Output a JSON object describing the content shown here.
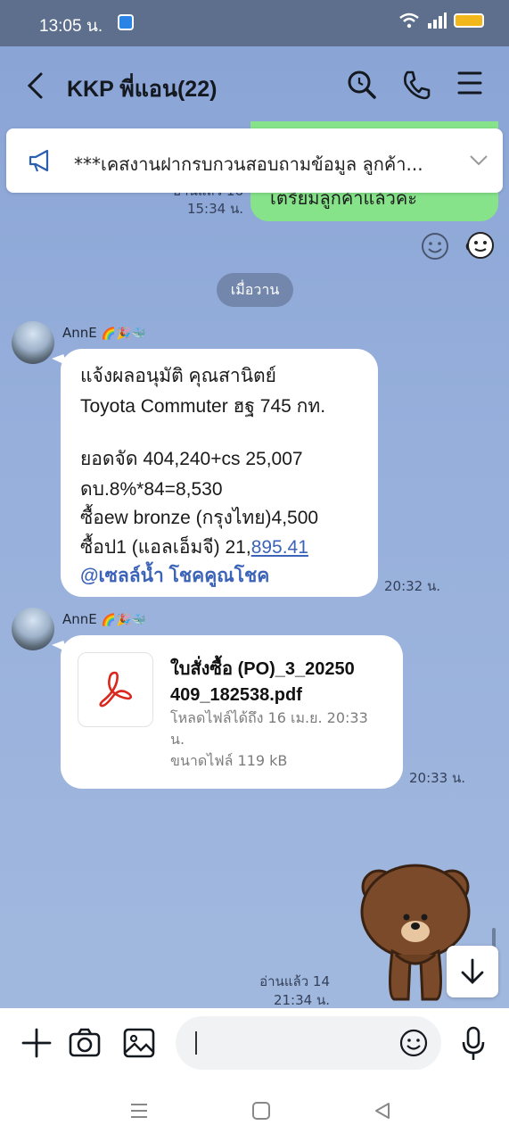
{
  "status_bar": {
    "time": "13:05 น."
  },
  "header": {
    "title": "KKP พี่แอน(22)"
  },
  "announcement": {
    "text": "***เคสงานฝากรบกวนสอบถามข้อมูล ลูกค้า..."
  },
  "previous_message": {
    "text": "เตรียมลูกค้าแล้วค่ะ",
    "read": "อ่านแล้ว 16",
    "time": "15:34 น."
  },
  "date_separator": "เมื่อวาน",
  "messages": [
    {
      "sender": "AnnE",
      "sender_emoji": "🌈🎉🐳",
      "lines": [
        "แจ้งผลอนุมัติ คุณสานิตย์",
        "Toyota Commuter ฮฐ 745 กท.",
        "ยอดจัด 404,240+cs 25,007",
        "ดบ.8%*84=8,530",
        "ซื้อew bronze (กรุงไทย)4,500"
      ],
      "last_line_prefix": "ซื้อป1 (แอลเอ็มจี) 21,",
      "last_line_link": "895.41",
      "mention": "@เซลล์น้ำ โชคคูณโชค",
      "time": "20:32 น."
    },
    {
      "sender": "AnnE",
      "sender_emoji": "🌈🎉🐳",
      "file_name_line1": "ใบสั่งซื้อ (PO)_3_20250",
      "file_name_line2": "409_182538.pdf",
      "download_line1": "โหลดไฟล์ได้ถึง 16 เม.ย. 20:33",
      "download_line2": "น.",
      "size": "ขนาดไฟล์ 119 kB",
      "time": "20:33 น."
    }
  ],
  "own_read": {
    "read": "อ่านแล้ว 14",
    "time": "21:34 น."
  },
  "input": {
    "placeholder": ""
  },
  "colors": {
    "own_bubble": "#86e38a",
    "link": "#3b63b8",
    "pdf_red": "#d9281e"
  }
}
